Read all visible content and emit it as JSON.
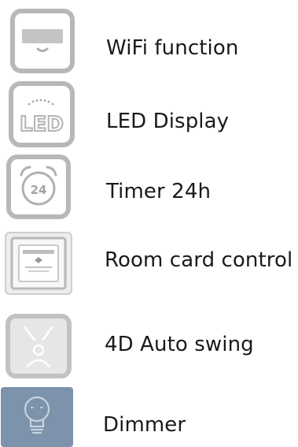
{
  "features": [
    {
      "label": "WiFi function",
      "icon": "wifi-ac-unit-icon"
    },
    {
      "label": "LED Display",
      "icon": "led-display-icon"
    },
    {
      "label": "Timer 24h",
      "icon": "alarm-clock-24-icon"
    },
    {
      "label": "Room card control",
      "icon": "room-card-slot-icon"
    },
    {
      "label": "4D Auto swing",
      "icon": "auto-swing-icon"
    },
    {
      "label": "Dimmer",
      "icon": "light-bulb-icon"
    }
  ],
  "colors": {
    "icon_border": "#b8b8b8",
    "icon_fill": "#c4c4c4",
    "dimmer_bg": "#7d93ab",
    "text": "#1a1a1a"
  }
}
